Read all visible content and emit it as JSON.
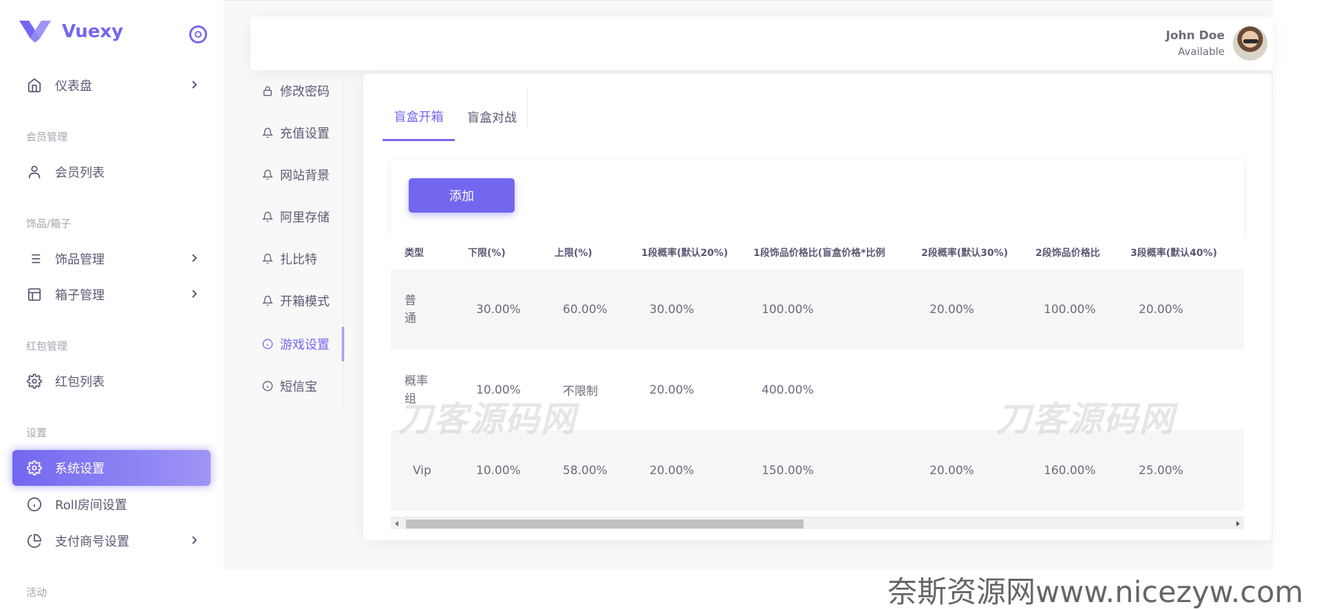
{
  "brand": {
    "name": "Vuexy"
  },
  "sidebar": {
    "items": [
      {
        "label": "仪表盘",
        "icon": "home-icon",
        "has_children": true
      },
      {
        "header": "会员管理"
      },
      {
        "label": "会员列表",
        "icon": "user-icon"
      },
      {
        "header": "饰品/箱子"
      },
      {
        "label": "饰品管理",
        "icon": "list-icon",
        "has_children": true
      },
      {
        "label": "箱子管理",
        "icon": "layout-icon",
        "has_children": true
      },
      {
        "header": "红包管理"
      },
      {
        "label": "红包列表",
        "icon": "gear-icon"
      },
      {
        "header": "设置"
      },
      {
        "label": "系统设置",
        "icon": "gear-icon",
        "active": true
      },
      {
        "label": "Roll房间设置",
        "icon": "info-icon"
      },
      {
        "label": "支付商号设置",
        "icon": "pie-chart-icon",
        "has_children": true
      },
      {
        "header": "活动"
      }
    ]
  },
  "user": {
    "name": "John Doe",
    "status": "Available"
  },
  "submenu": {
    "items": [
      {
        "label": "修改密码",
        "icon": "lock-icon"
      },
      {
        "label": "充值设置",
        "icon": "bell-icon"
      },
      {
        "label": "网站背景",
        "icon": "bell-icon"
      },
      {
        "label": "阿里存储",
        "icon": "bell-icon"
      },
      {
        "label": "扎比特",
        "icon": "bell-icon"
      },
      {
        "label": "开箱模式",
        "icon": "bell-icon"
      },
      {
        "label": "游戏设置",
        "icon": "info-icon",
        "active": true
      },
      {
        "label": "短信宝",
        "icon": "info-icon"
      }
    ]
  },
  "tabs": [
    {
      "label": "盲盒开箱",
      "active": true
    },
    {
      "label": "盲盒对战"
    }
  ],
  "toolbar": {
    "add_label": "添加"
  },
  "table": {
    "headers": [
      "类型",
      "下限(%)",
      "上限(%)",
      "1段概率(默认20%)",
      "1段饰品价格比(盲盒价格*比例",
      "2段概率(默认30%)",
      "2段饰品价格比",
      "3段概率(默认40%)"
    ],
    "rows": [
      [
        "普\n通",
        "30.00%",
        "60.00%",
        "30.00%",
        "100.00%",
        "20.00%",
        "100.00%",
        "20.00%"
      ],
      [
        "概率\n组",
        "10.00%",
        "不限制",
        "20.00%",
        "400.00%",
        "",
        "",
        ""
      ],
      [
        "Vip",
        "10.00%",
        "58.00%",
        "20.00%",
        "150.00%",
        "20.00%",
        "160.00%",
        "25.00%"
      ]
    ]
  },
  "watermarks": [
    "刀客源码网",
    "刀客源码网"
  ],
  "footer_watermark": "奈斯资源网www.nicezyw.com",
  "colors": {
    "primary": "#7367f0",
    "text": "#5e5873",
    "muted": "#a6a4b0",
    "canvas": "#f8f8f8"
  }
}
